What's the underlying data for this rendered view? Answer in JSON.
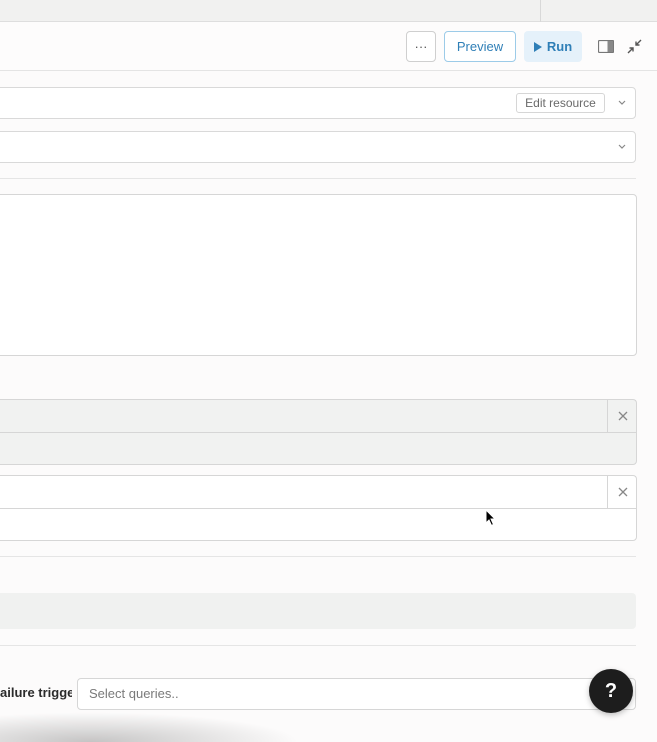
{
  "toolbar": {
    "more_label": "···",
    "preview_label": "Preview",
    "run_label": "Run",
    "accent_color": "#2f7fb7"
  },
  "resource": {
    "edit_resource_label": "Edit resource"
  },
  "event_handlers": {
    "failure_label": "ailure trigger",
    "failure_placeholder": "Select queries.."
  },
  "help": {
    "label": "?"
  },
  "icons": {
    "more": "ellipsis-icon",
    "run": "play-icon",
    "panel": "side-panel-icon",
    "collapse": "collapse-arrows-icon",
    "dropdown": "chevron-down-icon",
    "remove": "close-icon",
    "help": "question-icon",
    "cursor": "mouse-pointer-icon"
  }
}
